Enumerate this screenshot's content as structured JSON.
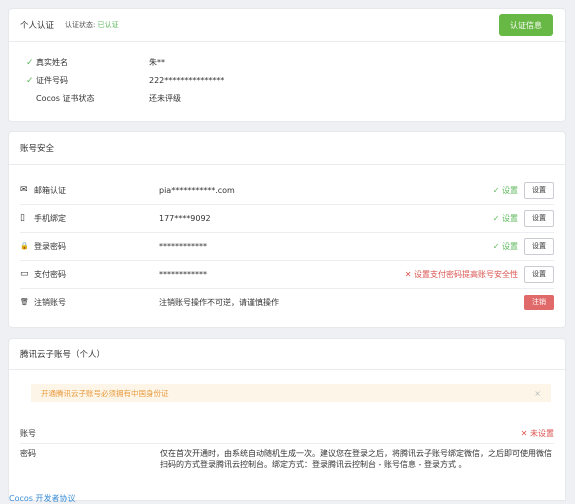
{
  "identity": {
    "title": "个人认证",
    "status_label": "认证状态:",
    "status_value": "已认证",
    "button": "认证信息",
    "rows": [
      {
        "check": "✓",
        "label": "真实姓名",
        "value": "朱**"
      },
      {
        "check": "✓",
        "label": "证件号码",
        "value": "222***************"
      },
      {
        "check": "",
        "label": "Cocos 证书状态",
        "value": "还未评级"
      }
    ]
  },
  "security": {
    "title": "账号安全",
    "rows": [
      {
        "icon": "✉",
        "label": "邮箱认证",
        "value": "pia***********.com",
        "status": "✓ 设置",
        "button": "设置"
      },
      {
        "icon": "▯",
        "label": "手机绑定",
        "value": "177****9092",
        "status": "✓ 设置",
        "button": "设置"
      },
      {
        "icon": "🔒",
        "label": "登录密码",
        "value": "************",
        "status": "✓ 设置",
        "button": "设置"
      },
      {
        "icon": "▭",
        "label": "支付密码",
        "value": "************",
        "status": "✕ 设置支付密码提高账号安全性",
        "button": "设置"
      },
      {
        "icon": "🗑",
        "label": "注销账号",
        "value": "注销账号操作不可逆，请谨慎操作",
        "status": "",
        "button": "注销"
      }
    ]
  },
  "tencent": {
    "title": "腾讯云子账号（个人）",
    "notice": "开通腾讯云子账号必须拥有中国身份证",
    "notice_close": "×",
    "account_label": "账号",
    "account_status": "✕ 未设置",
    "password_label": "密码",
    "password_desc": "仅在首次开通时，由系统自动随机生成一次。建议您在登录之后，将腾讯云子账号绑定微信，之后即可使用微信扫码的方式登录腾讯云控制台。绑定方式：登录腾讯云控制台 - 账号信息 - 登录方式 。"
  },
  "footer_link": "Cocos 开发者协议"
}
